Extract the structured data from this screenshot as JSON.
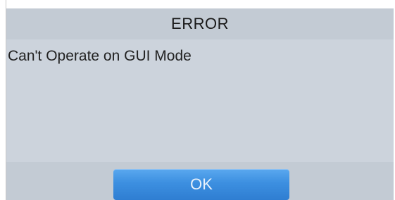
{
  "dialog": {
    "title": "ERROR",
    "message": "Can't Operate on GUI Mode",
    "ok_label": "OK"
  },
  "colors": {
    "dialog_background": "#ccd3dc",
    "title_bar": "#c3cbd4",
    "button_top": "#5aa8ef",
    "button_bottom": "#2f7ed2"
  }
}
